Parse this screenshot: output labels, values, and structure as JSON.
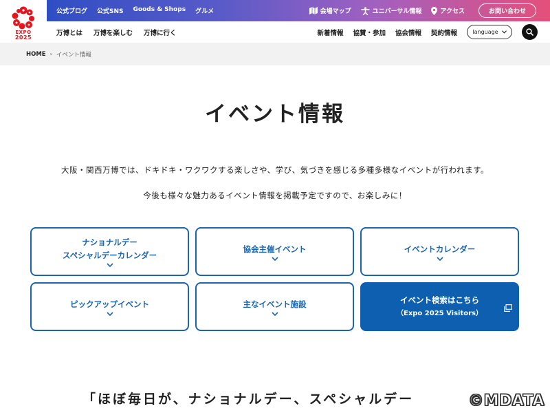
{
  "header": {
    "logo": {
      "line1": "EXPO",
      "line2": "2025"
    },
    "top_links": [
      "公式ブログ",
      "公式SNS",
      "Goods & Shops",
      "グルメ"
    ],
    "top_right": [
      {
        "icon": "map-icon",
        "label": "会場マップ"
      },
      {
        "icon": "universal-icon",
        "label": "ユニバーサル情報"
      },
      {
        "icon": "location-pin-icon",
        "label": "アクセス"
      }
    ],
    "contact_label": "お問い合わせ",
    "nav_left": [
      "万博とは",
      "万博を楽しむ",
      "万博に行く"
    ],
    "nav_right": [
      "新着情報",
      "協賛・参加",
      "協会情報",
      "契約情報"
    ],
    "language_label": "language",
    "colors": {
      "gradient_start": "#2f4ec4",
      "gradient_end": "#e5507a"
    }
  },
  "breadcrumb": {
    "home": "HOME",
    "current": "イベント情報"
  },
  "main": {
    "title": "イベント情報",
    "intro_line1": "大阪・関西万博では、ドキドキ・ワクワクする楽しさや、学び、気づきを感じる多種多様なイベントが行われます。",
    "intro_line2": "今後も様々な魅力あるイベント情報を掲載予定ですので、お楽しみに！",
    "cards": [
      {
        "line1": "ナショナルデー",
        "line2": "スペシャルデーカレンダー"
      },
      {
        "line1": "協会主催イベント"
      },
      {
        "line1": "イベントカレンダー"
      },
      {
        "line1": "ピックアップイベント"
      },
      {
        "line1": "主なイベント施設"
      },
      {
        "line1": "イベント検索はこちら",
        "line2": "（Expo 2025 Visitors）",
        "external": true
      }
    ],
    "accent_color": "#1a64b0",
    "bottom_heading": "「ほぼ毎日が、ナショナルデー、スペシャルデー"
  },
  "watermark": "©MDATA"
}
